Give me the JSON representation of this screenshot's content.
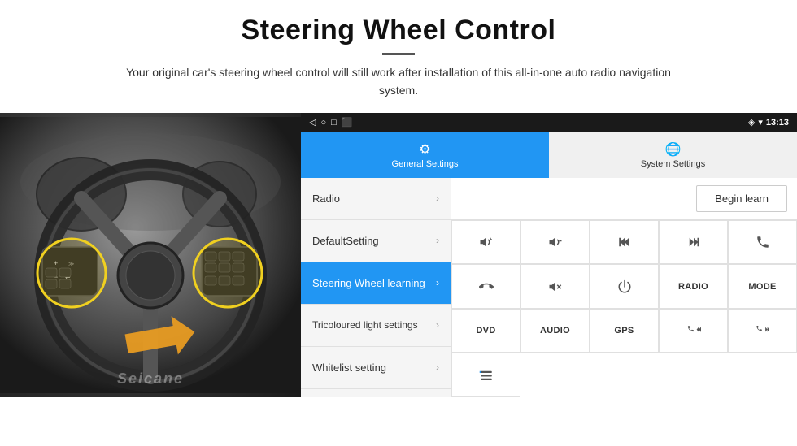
{
  "header": {
    "title": "Steering Wheel Control",
    "divider": true,
    "subtitle": "Your original car's steering wheel control will still work after installation of this all-in-one auto radio navigation system."
  },
  "statusbar": {
    "back_icon": "◁",
    "home_icon": "○",
    "recents_icon": "□",
    "screenshot_icon": "⬛",
    "wifi_icon": "▾",
    "signal_icon": "▴",
    "time": "13:13"
  },
  "tabs": [
    {
      "id": "general",
      "label": "General Settings",
      "active": true
    },
    {
      "id": "system",
      "label": "System Settings",
      "active": false
    }
  ],
  "menu_items": [
    {
      "id": "radio",
      "label": "Radio",
      "active": false
    },
    {
      "id": "default",
      "label": "DefaultSetting",
      "active": false
    },
    {
      "id": "steering",
      "label": "Steering Wheel learning",
      "active": true
    },
    {
      "id": "tricoloured",
      "label": "Tricoloured light settings",
      "active": false
    },
    {
      "id": "whitelist",
      "label": "Whitelist setting",
      "active": false
    }
  ],
  "begin_learn_label": "Begin learn",
  "control_buttons": [
    {
      "id": "vol-up",
      "symbol": "🔊+",
      "type": "icon"
    },
    {
      "id": "vol-down",
      "symbol": "🔉−",
      "type": "icon"
    },
    {
      "id": "prev",
      "symbol": "⏮",
      "type": "icon"
    },
    {
      "id": "next",
      "symbol": "⏭",
      "type": "icon"
    },
    {
      "id": "phone",
      "symbol": "📞",
      "type": "icon"
    },
    {
      "id": "hang-up",
      "symbol": "↩",
      "type": "icon"
    },
    {
      "id": "mute",
      "symbol": "🔇x",
      "type": "icon"
    },
    {
      "id": "power",
      "symbol": "⏻",
      "type": "icon"
    },
    {
      "id": "radio-btn",
      "label": "RADIO",
      "type": "text"
    },
    {
      "id": "mode-btn",
      "label": "MODE",
      "type": "text"
    },
    {
      "id": "dvd-btn",
      "label": "DVD",
      "type": "text"
    },
    {
      "id": "audio-btn",
      "label": "AUDIO",
      "type": "text"
    },
    {
      "id": "gps-btn",
      "label": "GPS",
      "type": "text"
    },
    {
      "id": "tel-prev",
      "symbol": "📞⏮",
      "type": "icon"
    },
    {
      "id": "tel-next",
      "symbol": "📞⏭",
      "type": "icon"
    },
    {
      "id": "list-btn",
      "symbol": "☰",
      "type": "icon"
    }
  ],
  "watermark": "Seicane"
}
